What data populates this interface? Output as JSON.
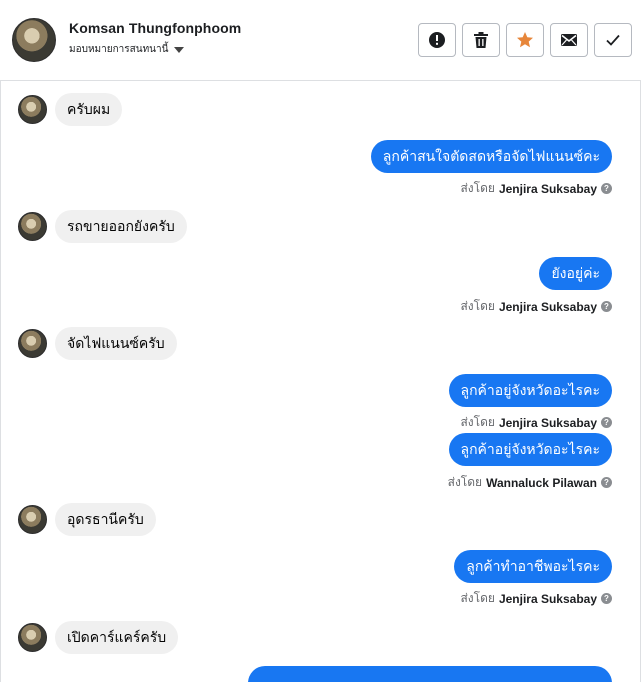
{
  "header": {
    "name": "Komsan Thungfonphoom",
    "assign_label": "มอบหมายการสนทนานี้",
    "actions": [
      "mark-spam",
      "delete",
      "star",
      "mark-unread",
      "mark-done"
    ]
  },
  "colors": {
    "outgoing_bubble": "#1877f2",
    "incoming_bubble": "#f0f0f0",
    "star": "#e7863a"
  },
  "sent_prefix": "ส่งโดย",
  "messages": [
    {
      "dir": "in",
      "text": "ครับผม"
    },
    {
      "dir": "out",
      "text": "ลูกค้าสนใจตัดสดหรือจัดไฟแนนซ์คะ",
      "sender": "Jenjira Suksabay"
    },
    {
      "dir": "in",
      "text": "รถขายออกยังครับ"
    },
    {
      "dir": "out",
      "text": "ยังอยู่ค่ะ",
      "sender": "Jenjira Suksabay"
    },
    {
      "dir": "in",
      "text": "จัดไฟแนนซ์ครับ"
    },
    {
      "dir": "out",
      "text": "ลูกค้าอยู่จังหวัดอะไรคะ",
      "sender": "Jenjira Suksabay"
    },
    {
      "dir": "out",
      "text": "ลูกค้าอยู่จังหวัดอะไรคะ",
      "sender": "Wannaluck Pilawan"
    },
    {
      "dir": "in",
      "text": "อุดรธานีครับ"
    },
    {
      "dir": "out",
      "text": "ลูกค้าทำอาชีพอะไรคะ",
      "sender": "Jenjira Suksabay"
    },
    {
      "dir": "in",
      "text": "เปิดคาร์แคร์ครับ"
    }
  ]
}
